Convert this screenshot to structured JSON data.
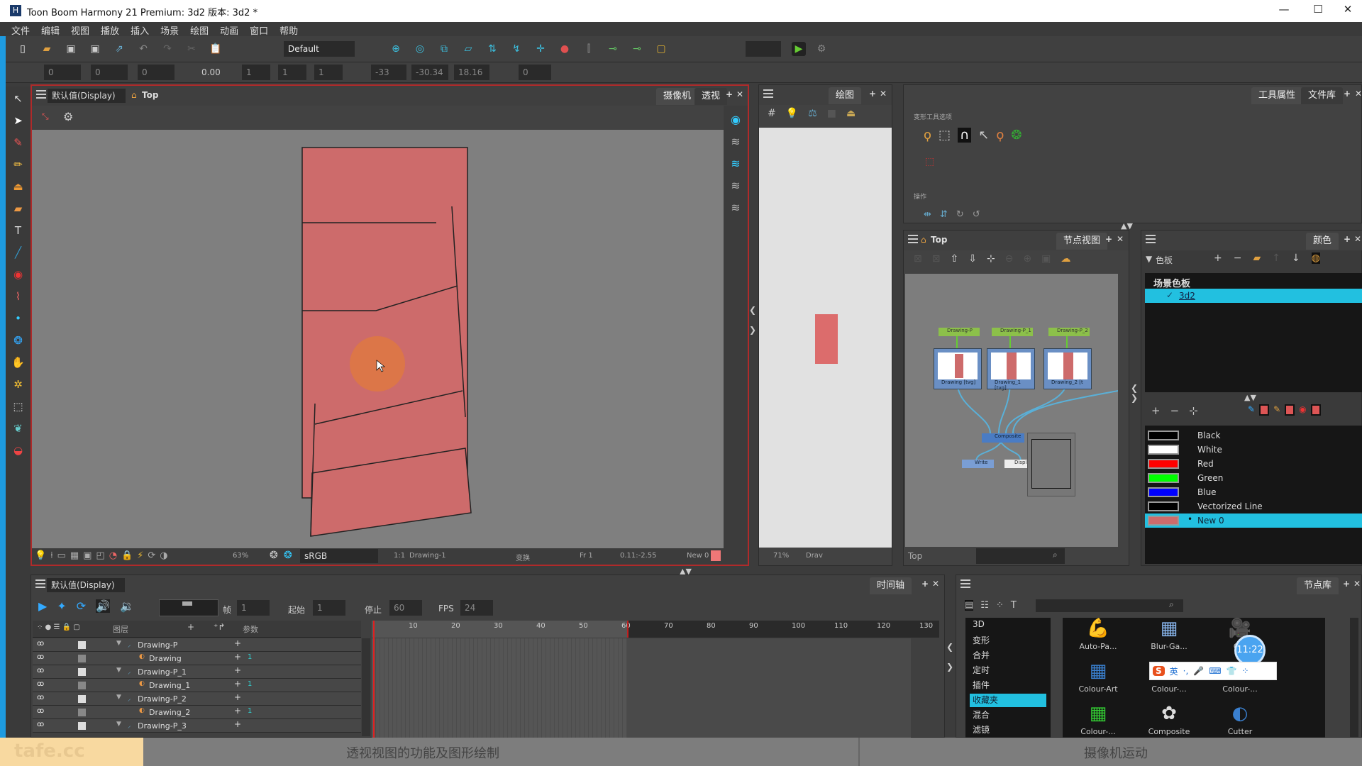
{
  "window": {
    "title": "Toon Boom Harmony 21 Premium: 3d2 版本: 3d2 *",
    "controls": [
      "—",
      "☐",
      "✕"
    ]
  },
  "menu": [
    "文件",
    "编辑",
    "视图",
    "播放",
    "插入",
    "场景",
    "绘图",
    "动画",
    "窗口",
    "帮助"
  ],
  "toolbar": {
    "workspace": "Default"
  },
  "transform_bar": {
    "values": [
      "0",
      "0",
      "0",
      "0.00",
      "1",
      "1",
      "1",
      "-33",
      "-30.34",
      "18.16",
      "0"
    ]
  },
  "camera_view": {
    "view_mode": "默认值(Display)",
    "breadcrumb": "Top",
    "tabs": [
      "摄像机",
      "透视"
    ],
    "status": {
      "zoom": "63%",
      "color_space": "sRGB",
      "ratio": "1:1",
      "drawing": "Drawing-1",
      "tool": "变换",
      "frame": "Fr 1",
      "coords": "0.11:-2.55",
      "color": "New 0"
    },
    "shape_color": "#cd6b6b",
    "cursor_highlight": "#e07a3c",
    "border_color": "#b02a2a"
  },
  "drawing_view": {
    "tab": "绘图",
    "zoom": "71%",
    "drawing": "Drav"
  },
  "tool_properties": {
    "tabs": [
      "工具属性",
      "文件库"
    ],
    "section_options": "变形工具选项",
    "section_ops": "操作"
  },
  "node_view": {
    "breadcrumb": "Top",
    "tab": "节点视图",
    "nodes": {
      "pegs": [
        "Drawing-P",
        "Drawing-P_1",
        "Drawing-P_2"
      ],
      "drawings": [
        "Drawing  [tvg]",
        "Drawing_1  [tvg]",
        "Drawing_2  [t"
      ],
      "composite": "Composite",
      "write": "Write",
      "display": "Displ"
    },
    "footer": "Top"
  },
  "color_panel": {
    "tab": "颜色",
    "palette_label": "色板",
    "scene_palette": "场景色板",
    "palette_name": "3d2",
    "colors": [
      {
        "name": "Black",
        "hex": "#000000"
      },
      {
        "name": "White",
        "hex": "#ffffff"
      },
      {
        "name": "Red",
        "hex": "#ff0000"
      },
      {
        "name": "Green",
        "hex": "#00ff00"
      },
      {
        "name": "Blue",
        "hex": "#0000ff"
      },
      {
        "name": "Vectorized Line",
        "hex": "#000000"
      },
      {
        "name": "New 0",
        "hex": "#cd6b6b",
        "selected": true
      }
    ]
  },
  "timeline": {
    "view_mode": "默认值(Display)",
    "tab": "时间轴",
    "frame_label": "帧",
    "frame": "1",
    "start_label": "起始",
    "start": "1",
    "stop_label": "停止",
    "stop": "60",
    "fps_label": "FPS",
    "fps": "24",
    "col_layers": "图层",
    "col_params": "参数",
    "layers": [
      {
        "name": "Drawing-P",
        "peg": true,
        "value": ""
      },
      {
        "name": "Drawing",
        "peg": false,
        "value": "1"
      },
      {
        "name": "Drawing-P_1",
        "peg": true,
        "value": ""
      },
      {
        "name": "Drawing_1",
        "peg": false,
        "value": "1"
      },
      {
        "name": "Drawing-P_2",
        "peg": true,
        "value": ""
      },
      {
        "name": "Drawing_2",
        "peg": false,
        "value": "1"
      },
      {
        "name": "Drawing-P_3",
        "peg": true,
        "value": ""
      }
    ],
    "ruler": [
      "10",
      "20",
      "30",
      "40",
      "50",
      "60",
      "70",
      "80",
      "90",
      "100",
      "110",
      "120",
      "130"
    ],
    "current_frame": 1,
    "scene_length": 60
  },
  "library": {
    "tab": "节点库",
    "categories": [
      "3D",
      "变形",
      "合并",
      "定时",
      "插件",
      "收藏夹",
      "混合",
      "滤镜"
    ],
    "selected_category": "收藏夹",
    "items": [
      "Auto-Pa...",
      "Blur-Ga...",
      "C...",
      "Colour-Art",
      "Colour-...",
      "Colour-...",
      "Colour-...",
      "Composite",
      "Cutter"
    ]
  },
  "overlays": {
    "clock": "11:22",
    "ime": [
      "英",
      "·,",
      "🎤",
      "⌨",
      "👕",
      "⁘"
    ]
  },
  "captions": {
    "left": "透视视图的功能及图形绘制",
    "right": "摄像机运动",
    "watermark": "tafe.cc"
  }
}
